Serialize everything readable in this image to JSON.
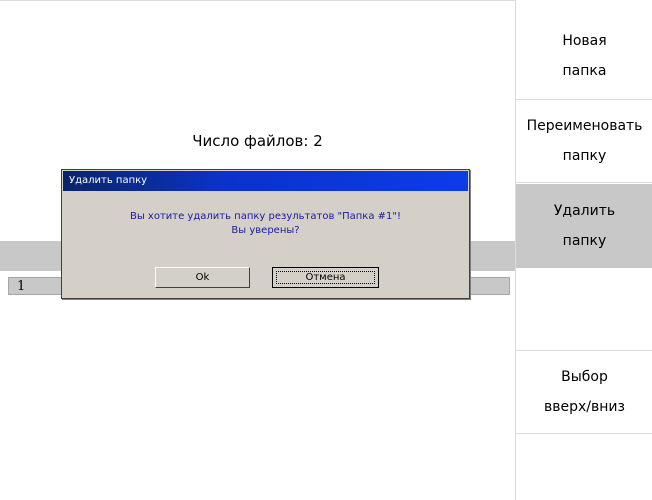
{
  "main": {
    "file_count_text": "Число файлов: 2",
    "list": [
      {
        "index": "1"
      }
    ]
  },
  "softkeys": [
    {
      "line1": "Новая",
      "line2": "папка",
      "active": false
    },
    {
      "line1": "Переименовать",
      "line2": "папку",
      "active": false
    },
    {
      "line1": "Удалить",
      "line2": "папку",
      "active": true
    },
    {
      "line1": "",
      "line2": "",
      "active": false
    },
    {
      "line1": "Выбор",
      "line2": "вверх/вниз",
      "active": false
    },
    {
      "line1": "",
      "line2": "",
      "active": false
    }
  ],
  "dialog": {
    "title": "Удалить папку",
    "message_line1": "Вы хотите удалить папку результатов \"Папка #1\"!",
    "message_line2": "Вы уверены?",
    "ok_label": "Ok",
    "cancel_label": "Отмена"
  },
  "colors": {
    "highlight": "#c8c8c8",
    "dialog_bg": "#d4d0c8",
    "titlebar": "#0b33c9",
    "message_text": "#1a1aa0"
  }
}
